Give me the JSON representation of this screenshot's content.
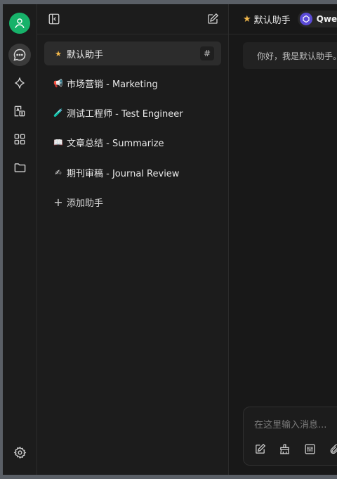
{
  "sidebar": {
    "nav": [
      {
        "icon": "chat-icon",
        "active": true
      },
      {
        "icon": "sparkle-icon",
        "active": false
      },
      {
        "icon": "translate-icon",
        "active": false
      },
      {
        "icon": "apps-icon",
        "active": false
      },
      {
        "icon": "folder-icon",
        "active": false
      }
    ],
    "settings_icon": "gear-icon",
    "avatar_color": "#17b26a"
  },
  "assistants": {
    "items": [
      {
        "emoji": "★",
        "label": "默认助手",
        "active": true
      },
      {
        "emoji": "📢",
        "label": "市场营销 - Marketing",
        "active": false
      },
      {
        "emoji": "🧪",
        "label": "测试工程师 - Test Engineer",
        "active": false
      },
      {
        "emoji": "📖",
        "label": "文章总结 - Summarize",
        "active": false
      },
      {
        "emoji": "✍",
        "label": "期刊审稿 - Journal Review",
        "active": false
      }
    ],
    "hash_label": "#",
    "add_label": "添加助手",
    "add_symbol": "+"
  },
  "chat": {
    "title_star": "★",
    "title": "默认助手",
    "model": "Qwen",
    "greeting": "你好，我是默认助手。",
    "input_placeholder": "在这里输入消息..."
  },
  "colors": {
    "accent": "#17b26a",
    "star": "#f2b84b",
    "model_logo": "#5b4bd6"
  }
}
